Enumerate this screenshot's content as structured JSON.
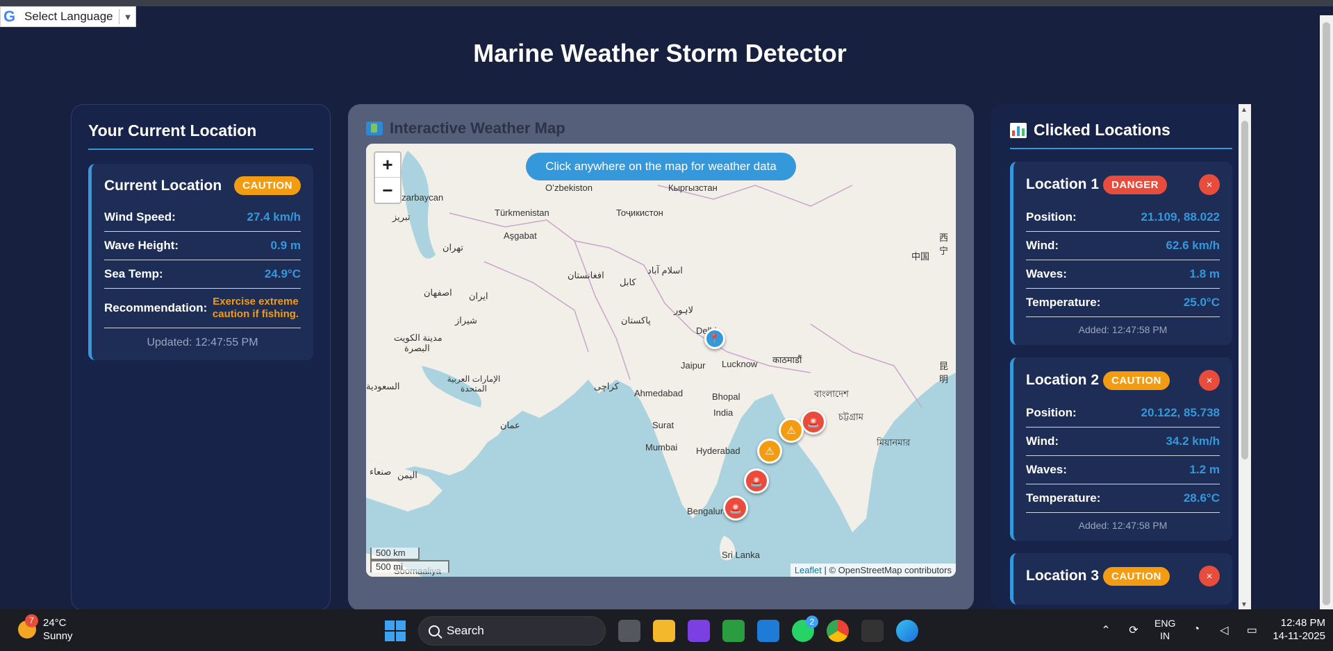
{
  "language_widget": {
    "label": "Select Language",
    "arrow": "▼"
  },
  "page": {
    "title": "Marine Weather Storm Detector"
  },
  "current_panel": {
    "heading": "Your Current Location",
    "card": {
      "title": "Current Location",
      "status": "CAUTION",
      "rows": [
        {
          "label": "Wind Speed:",
          "value": "27.4 km/h"
        },
        {
          "label": "Wave Height:",
          "value": "0.9 m"
        },
        {
          "label": "Sea Temp:",
          "value": "24.9°C"
        },
        {
          "label": "Recommendation:",
          "value": "Exercise extreme caution if fishing."
        }
      ],
      "updated": "Updated: 12:47:55 PM"
    }
  },
  "map_panel": {
    "heading": "Interactive Weather Map",
    "banner": "Click anywhere on the map for weather data",
    "zoom_in": "+",
    "zoom_out": "−",
    "scale_km": "500 km",
    "scale_mi": "500 mi",
    "attribution_link": "Leaflet",
    "attribution_text": "| © OpenStreetMap contributors",
    "labels": [
      {
        "text": "Türkmenistan"
      },
      {
        "text": "Aşgabat"
      },
      {
        "text": "Oʻzbekiston"
      },
      {
        "text": "Кыргызстан"
      },
      {
        "text": "Тоҷикистон"
      },
      {
        "text": "افغانستان"
      },
      {
        "text": "کابل"
      },
      {
        "text": "اسلام آباد"
      },
      {
        "text": "پاکستان"
      },
      {
        "text": "لاہور"
      },
      {
        "text": "Delhi"
      },
      {
        "text": "Jaipur"
      },
      {
        "text": "Lucknow"
      },
      {
        "text": "काठमाडौं"
      },
      {
        "text": "Ahmedabad"
      },
      {
        "text": "Bhopal"
      },
      {
        "text": "India"
      },
      {
        "text": "Surat"
      },
      {
        "text": "Mumbai"
      },
      {
        "text": "Hyderabad"
      },
      {
        "text": "Bengaluru"
      },
      {
        "text": "Sri Lanka"
      },
      {
        "text": "ایران"
      },
      {
        "text": "اصفهان"
      },
      {
        "text": "شیراز"
      },
      {
        "text": "تهران"
      },
      {
        "text": "کراچی"
      },
      {
        "text": "السعودية"
      },
      {
        "text": "عمان"
      },
      {
        "text": "اليمن"
      },
      {
        "text": "মিয়ানমার"
      },
      {
        "text": "中国"
      },
      {
        "text": "Soomaaliya"
      },
      {
        "text": "azarbaycan"
      },
      {
        "text": "تبریز"
      },
      {
        "text": "البصرة"
      },
      {
        "text": "مدينة الكويت"
      },
      {
        "text": "الإمارات العربية المتحدة"
      },
      {
        "text": "صنعاء"
      },
      {
        "text": "বাংলাদেশ"
      },
      {
        "text": "চট্টগ্রাম"
      },
      {
        "text": "昆明"
      },
      {
        "text": "西宁"
      }
    ],
    "markers": [
      {
        "type": "location",
        "color": "blue",
        "icon": "pin-icon"
      },
      {
        "type": "danger",
        "color": "red",
        "icon": "siren-icon"
      },
      {
        "type": "caution",
        "color": "orange",
        "icon": "warning-icon"
      },
      {
        "type": "caution",
        "color": "orange",
        "icon": "warning-icon"
      },
      {
        "type": "danger",
        "color": "red",
        "icon": "siren-icon"
      },
      {
        "type": "danger",
        "color": "red",
        "icon": "siren-icon"
      }
    ]
  },
  "clicked_panel": {
    "heading": "Clicked Locations",
    "close_symbol": "×",
    "locations": [
      {
        "title": "Location 1",
        "status": "DANGER",
        "rows": [
          {
            "label": "Position:",
            "value": "21.109, 88.022"
          },
          {
            "label": "Wind:",
            "value": "62.6 km/h"
          },
          {
            "label": "Waves:",
            "value": "1.8 m"
          },
          {
            "label": "Temperature:",
            "value": "25.0°C"
          }
        ],
        "added": "Added: 12:47:58 PM"
      },
      {
        "title": "Location 2",
        "status": "CAUTION",
        "rows": [
          {
            "label": "Position:",
            "value": "20.122, 85.738"
          },
          {
            "label": "Wind:",
            "value": "34.2 km/h"
          },
          {
            "label": "Waves:",
            "value": "1.2 m"
          },
          {
            "label": "Temperature:",
            "value": "28.6°C"
          }
        ],
        "added": "Added: 12:47:58 PM"
      },
      {
        "title": "Location 3",
        "status": "CAUTION"
      }
    ]
  },
  "taskbar": {
    "weather_badge": "7",
    "temperature": "24°C",
    "condition": "Sunny",
    "search_placeholder": "Search",
    "whatsapp_badge": "2",
    "lang_line1": "ENG",
    "lang_line2": "IN",
    "time": "12:48 PM",
    "date": "14-11-2025"
  },
  "colors": {
    "accent": "#3498db",
    "danger": "#e74c3c",
    "caution": "#f39c12",
    "background": "#17213f"
  }
}
